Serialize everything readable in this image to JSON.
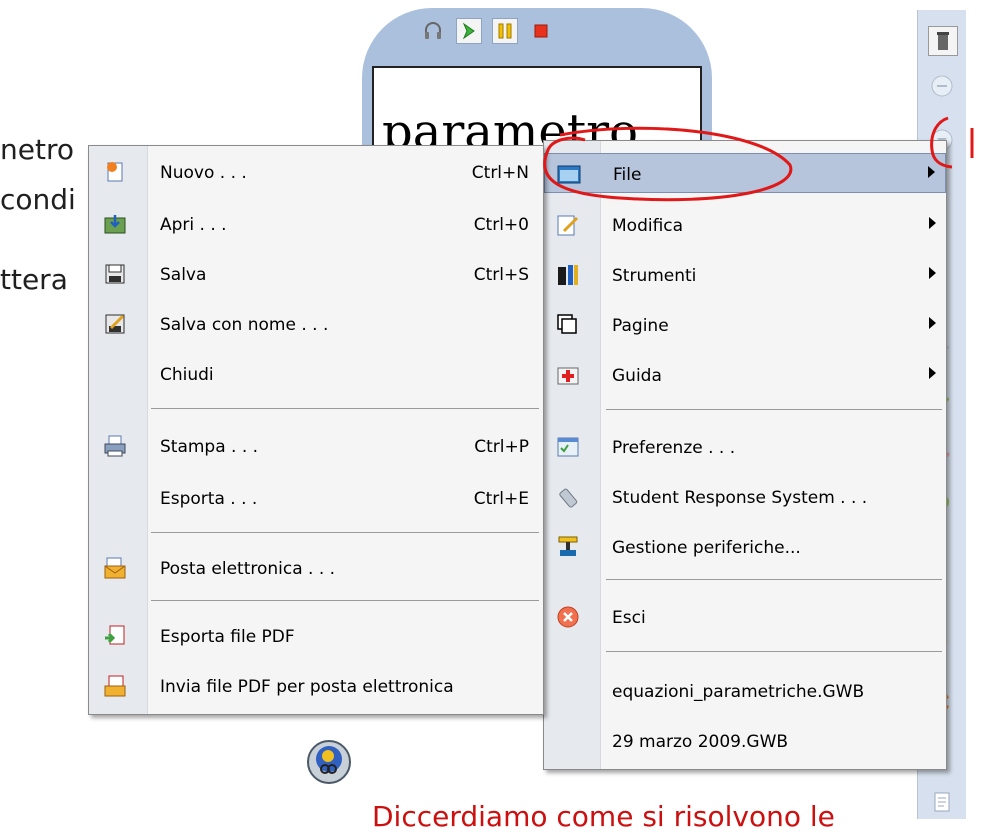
{
  "background": {
    "line1": "netro",
    "line2": "condi",
    "line3": "ttera",
    "bottom_text": "Diccerdiamo come si risolvono le"
  },
  "player": {
    "text": "parametro",
    "buttons": [
      "headphones-icon",
      "play-icon",
      "pause-icon",
      "stop-icon"
    ]
  },
  "main_menu": {
    "items": [
      {
        "label": "File",
        "icon": "folder-icon",
        "submenu": true
      },
      {
        "label": "Modifica",
        "icon": "edit-icon",
        "submenu": true
      },
      {
        "label": "Strumenti",
        "icon": "tools-icon",
        "submenu": true
      },
      {
        "label": "Pagine",
        "icon": "pages-icon",
        "submenu": true
      },
      {
        "label": "Guida",
        "icon": "help-icon",
        "submenu": true
      },
      {
        "label": "Preferenze . . .",
        "icon": "preferences-icon"
      },
      {
        "label": "Student Response System . . .",
        "icon": "remote-icon"
      },
      {
        "label": "Gestione periferiche...",
        "icon": "devices-icon"
      },
      {
        "label": "Esci",
        "icon": "exit-icon"
      },
      {
        "label": "equazioni_parametriche.GWB"
      },
      {
        "label": "29 marzo 2009.GWB"
      }
    ]
  },
  "file_menu": {
    "items": [
      {
        "label": "Nuovo . . .",
        "shortcut": "Ctrl+N",
        "icon": "new-file-icon"
      },
      {
        "label": "Apri . . .",
        "shortcut": "Ctrl+0",
        "icon": "open-icon"
      },
      {
        "label": "Salva",
        "shortcut": "Ctrl+S",
        "icon": "save-icon"
      },
      {
        "label": "Salva con nome . . .",
        "icon": "save-as-icon"
      },
      {
        "label": "Chiudi"
      },
      {
        "label": "Stampa . . .",
        "shortcut": "Ctrl+P",
        "icon": "print-icon"
      },
      {
        "label": "Esporta . . .",
        "shortcut": "Ctrl+E"
      },
      {
        "label": "Posta elettronica . . .",
        "icon": "email-icon"
      },
      {
        "label": "Esporta file PDF",
        "icon": "export-pdf-icon"
      },
      {
        "label": "Invia file PDF per posta elettronica",
        "icon": "send-pdf-icon"
      }
    ]
  },
  "colors": {
    "highlight": "#b6c4dc",
    "annotation_red": "#e01818",
    "player_frame": "#aac0dc"
  }
}
